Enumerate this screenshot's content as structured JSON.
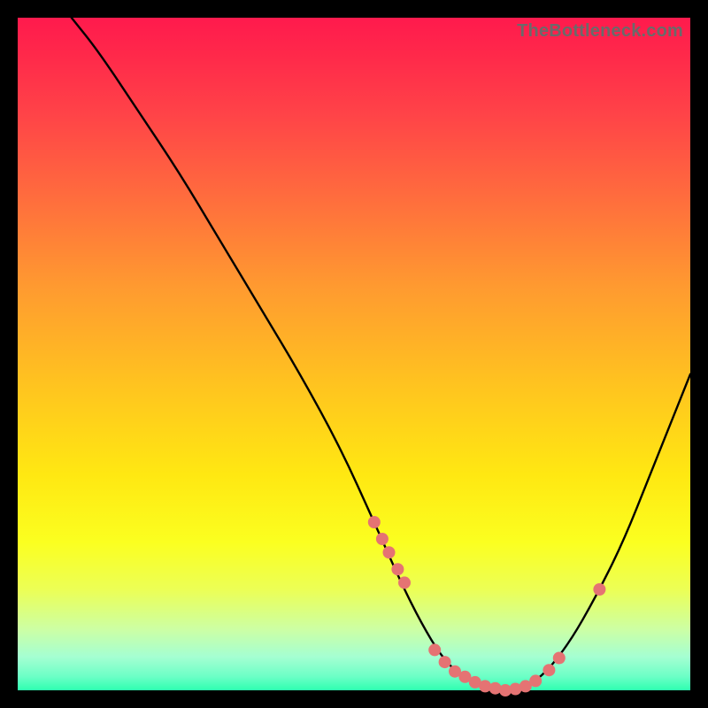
{
  "watermark": "TheBottleneck.com",
  "colors": {
    "dot": "#e57373",
    "curve": "#000000",
    "frame_bg": "#000000"
  },
  "chart_data": {
    "type": "line",
    "title": "",
    "xlabel": "",
    "ylabel": "",
    "xlim": [
      0,
      100
    ],
    "ylim": [
      0,
      100
    ],
    "series": [
      {
        "name": "bottleneck-curve",
        "x": [
          8,
          12,
          18,
          24,
          30,
          36,
          42,
          48,
          53,
          57,
          60,
          63,
          66,
          69,
          72,
          75,
          78,
          82,
          86,
          90,
          94,
          98,
          100
        ],
        "y": [
          100,
          95,
          86,
          77,
          67,
          57,
          47,
          36,
          25,
          16,
          10,
          5,
          2,
          0.5,
          0,
          0.5,
          2,
          7,
          14,
          22,
          32,
          42,
          47
        ]
      }
    ],
    "markers": {
      "name": "highlight-dots",
      "x": [
        53.0,
        54.2,
        55.2,
        56.5,
        57.5,
        62.0,
        63.5,
        65.0,
        66.5,
        68.0,
        69.5,
        71.0,
        72.5,
        74.0,
        75.5,
        77.0,
        79.0,
        80.5,
        86.5
      ],
      "y": [
        25.0,
        22.5,
        20.5,
        18.0,
        16.0,
        6.0,
        4.2,
        2.8,
        2.0,
        1.2,
        0.6,
        0.3,
        0.0,
        0.2,
        0.6,
        1.4,
        3.0,
        4.8,
        15.0
      ]
    }
  }
}
